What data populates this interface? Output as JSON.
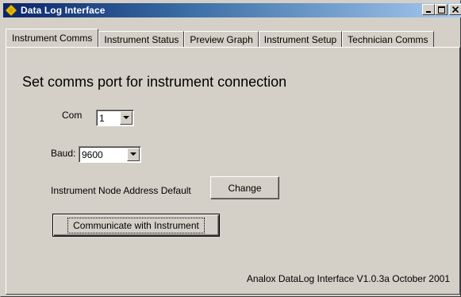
{
  "window": {
    "title": "Data Log Interface",
    "controls": {
      "minimize": "_",
      "maximize": "□",
      "close": "×"
    }
  },
  "tabs": [
    {
      "label": "Instrument Comms",
      "active": true
    },
    {
      "label": "Instrument Status",
      "active": false
    },
    {
      "label": "Preview Graph",
      "active": false
    },
    {
      "label": "Instrument Setup",
      "active": false
    },
    {
      "label": "Technician Comms",
      "active": false
    }
  ],
  "panel": {
    "heading": "Set comms port for instrument connection",
    "com": {
      "label": "Com",
      "value": "1"
    },
    "baud": {
      "label": "Baud:",
      "value": "9600"
    },
    "node_address": {
      "label": "Instrument Node Address Default",
      "button": "Change"
    },
    "communicate_button": "Communicate with Instrument",
    "footer": "Analox DataLog Interface V1.0.3a  October 2001"
  },
  "colors": {
    "face": "#d4d0c8",
    "title_start": "#0a246a",
    "title_end": "#a6caf0",
    "icon": "#f0c800"
  }
}
